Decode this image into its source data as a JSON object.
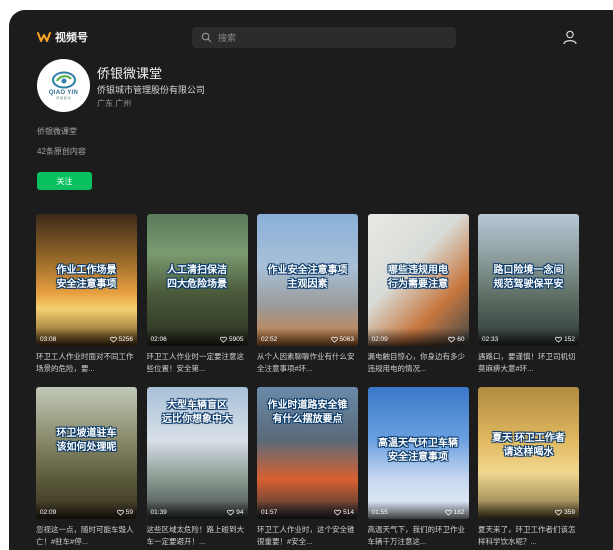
{
  "header": {
    "brand_name": "视频号",
    "search_placeholder": "搜索"
  },
  "profile": {
    "name": "侨银微课堂",
    "company": "侨银城市管理股份有限公司",
    "location": "广东 广州",
    "description": "侨银微课堂",
    "content_count": "42条原创内容",
    "follow_label": "关注",
    "avatar_logo_text": "QIAO YIN",
    "avatar_logo_sub": "侨 银 股 份"
  },
  "videos": [
    {
      "title": "作业工作场景\n安全注意事项",
      "duration": "03:08",
      "likes": "5256",
      "caption": "环卫工人作业时面对不同工作场景的危险，要..."
    },
    {
      "title": "人工清扫保洁\n四大危险场景",
      "duration": "02:06",
      "likes": "5905",
      "caption": "环卫工人作业时一定要注意这些位置！安全第..."
    },
    {
      "title": "作业安全注意事项\n主观因素",
      "duration": "02:52",
      "likes": "5063",
      "caption": "从个人因素聊聊作业有什么安全注意事项#环..."
    },
    {
      "title": "哪些违规用电\n行为需要注意",
      "duration": "02:09",
      "likes": "60",
      "caption": "漏电触目惊心，你身边有多少违规用电的情况..."
    },
    {
      "title": "路口险境一念间\n规范驾驶保平安",
      "duration": "02:33",
      "likes": "152",
      "caption": "遇路口，要谨慎！环卫司机切莫麻痹大意#环..."
    },
    {
      "title": "环卫坡道驻车\n该如何处理呢",
      "duration": "02:09",
      "likes": "59",
      "caption": "忽视这一点，随时可能车毁人亡！#驻车#停..."
    },
    {
      "title": "大型车辆盲区\n远比你想象中大",
      "duration": "01:39",
      "likes": "94",
      "caption": "这些区域太危险！路上碰到大车一定要避开！..."
    },
    {
      "title": "作业时道路安全锥\n有什么摆放要点",
      "duration": "01:57",
      "likes": "514",
      "caption": "环卫工人作业时，这个安全锥很重要！#安全..."
    },
    {
      "title": "高温天气环卫车辆\n安全注意事项",
      "duration": "01:55",
      "likes": "182",
      "caption": "高温天气下，我们的环卫作业车辆千万注意这..."
    },
    {
      "title": "夏天 环卫工作者\n请这样喝水",
      "duration": "",
      "likes": "359",
      "caption": "夏天来了，环卫工作者们该怎样科学饮水呢？..."
    }
  ]
}
